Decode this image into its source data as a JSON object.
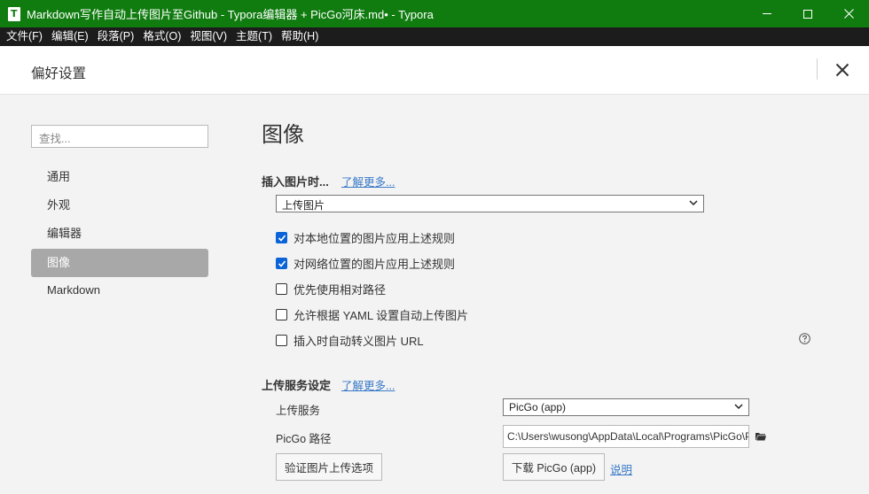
{
  "window": {
    "title": "Markdown写作自动上传图片至Github - Typora编辑器 + PicGo河床.md• - Typora"
  },
  "menu": [
    "文件(F)",
    "编辑(E)",
    "段落(P)",
    "格式(O)",
    "视图(V)",
    "主题(T)",
    "帮助(H)"
  ],
  "prefs": {
    "title": "偏好设置",
    "search_placeholder": "查找...",
    "nav": [
      "通用",
      "外观",
      "编辑器",
      "图像",
      "Markdown"
    ],
    "active_nav": "图像"
  },
  "image": {
    "heading": "图像",
    "insert_label": "插入图片时...",
    "learn_more": "了解更多...",
    "insert_action": "上传图片",
    "options": [
      {
        "label": "对本地位置的图片应用上述规则",
        "checked": true
      },
      {
        "label": "对网络位置的图片应用上述规则",
        "checked": true
      },
      {
        "label": "优先使用相对路径",
        "checked": false
      },
      {
        "label": "允许根据 YAML 设置自动上传图片",
        "checked": false
      },
      {
        "label": "插入时自动转义图片 URL",
        "checked": false
      }
    ],
    "upload_section_label": "上传服务设定",
    "upload_learn_more": "了解更多...",
    "upload_service_label": "上传服务",
    "upload_service_value": "PicGo (app)",
    "picgo_path_label": "PicGo 路径",
    "picgo_path_value": "C:\\Users\\wusong\\AppData\\Local\\Programs\\PicGo\\PicGo.exe",
    "verify_button": "验证图片上传选项",
    "download_button": "下载 PicGo (app)",
    "help_link": "说明"
  },
  "colors": {
    "titlebar": "#107c10",
    "menubar": "#1c1c1c",
    "checkbox_checked": "#0a64d8",
    "active_nav": "#a8a8a8",
    "link": "#3a7ac8"
  }
}
